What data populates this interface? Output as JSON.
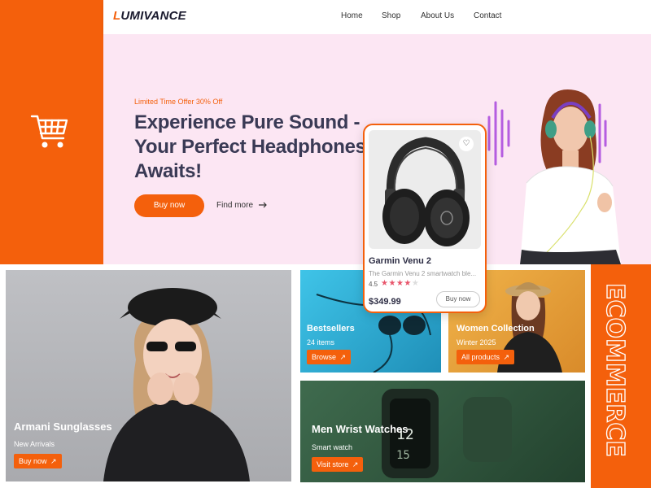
{
  "brand": {
    "name_first": "L",
    "name_rest": "UMIVANCE",
    "accent": "#f4600c"
  },
  "nav": [
    {
      "label": "Home"
    },
    {
      "label": "Shop"
    },
    {
      "label": "About Us"
    },
    {
      "label": "Contact"
    }
  ],
  "hero": {
    "offer": "Limited Time Offer 30% Off",
    "headline": "Experience Pure Sound - Your Perfect Headphones Awaits!",
    "buy_label": "Buy now",
    "find_more_label": "Find more",
    "background": "#fce6f3"
  },
  "product_card": {
    "name": "Garmin Venu 2",
    "description": "The Garmin Venu 2 smartwatch ble...",
    "rating": "4.5",
    "stars_filled": 4,
    "stars_total": 5,
    "price": "$349.99",
    "buy_label": "Buy now",
    "icon": "heart-icon"
  },
  "tiles": {
    "armani": {
      "title": "Armani Sunglasses",
      "subtitle": "New Arrivals",
      "button": "Buy now",
      "icon": "external-link-icon"
    },
    "bestsellers": {
      "title": "Bestsellers",
      "subtitle": "24 items",
      "button": "Browse",
      "icon": "external-link-icon"
    },
    "women": {
      "title": "Women Collection",
      "subtitle": "Winter 2025",
      "button": "All products",
      "icon": "external-link-icon"
    },
    "watches": {
      "title": "Men Wrist Watches",
      "subtitle": "Smart watch",
      "button": "Visit store",
      "icon": "external-link-icon"
    }
  },
  "side_banner": {
    "text": "ECOMMERCE"
  },
  "icons": {
    "cart": "shopping-cart-icon",
    "arrow": "arrow-right-icon"
  }
}
